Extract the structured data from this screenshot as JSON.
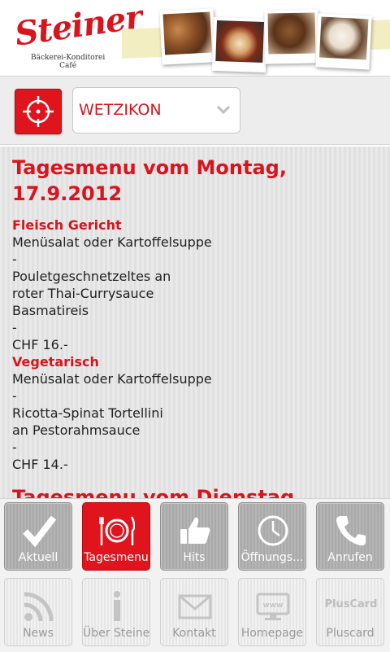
{
  "header": {
    "logo_text": "Steiner",
    "logo_subtitle_line1": "Bäckerei-Konditorei",
    "logo_subtitle_line2": "Café"
  },
  "location": {
    "selected": "WETZIKON"
  },
  "menu": {
    "day1_title": "Tagesmenu vom Montag, 17.9.2012",
    "sections": [
      {
        "category": "Fleisch Gericht",
        "lines": [
          "Menüsalat oder Kartoffelsuppe",
          "-",
          "Pouletgeschnetzeltes an",
          "roter Thai-Currysauce",
          "Basmatireis",
          "-",
          "CHF 16.-"
        ]
      },
      {
        "category": "Vegetarisch",
        "lines": [
          "Menüsalat oder Kartoffelsuppe",
          "-",
          "Ricotta-Spinat Tortellini",
          "an Pestorahmsauce",
          "-",
          "CHF 14.-"
        ]
      }
    ],
    "day2_title": "Tagesmenu vom Dienstag,"
  },
  "nav": {
    "aktuell": "Aktuell",
    "tagesmenu": "Tagesmenu",
    "hits": "Hits",
    "oeffnungs": "Öffnungs...",
    "anrufen": "Anrufen",
    "news": "News",
    "ueber": "Über Steiner",
    "kontakt": "Kontakt",
    "homepage": "Homepage",
    "pluscard": "Pluscard",
    "homepage_icon_text": "www",
    "pluscard_icon_text": "PlusCard"
  },
  "colors": {
    "brand_red": "#d9141c",
    "active_tile": "#e0141c"
  }
}
